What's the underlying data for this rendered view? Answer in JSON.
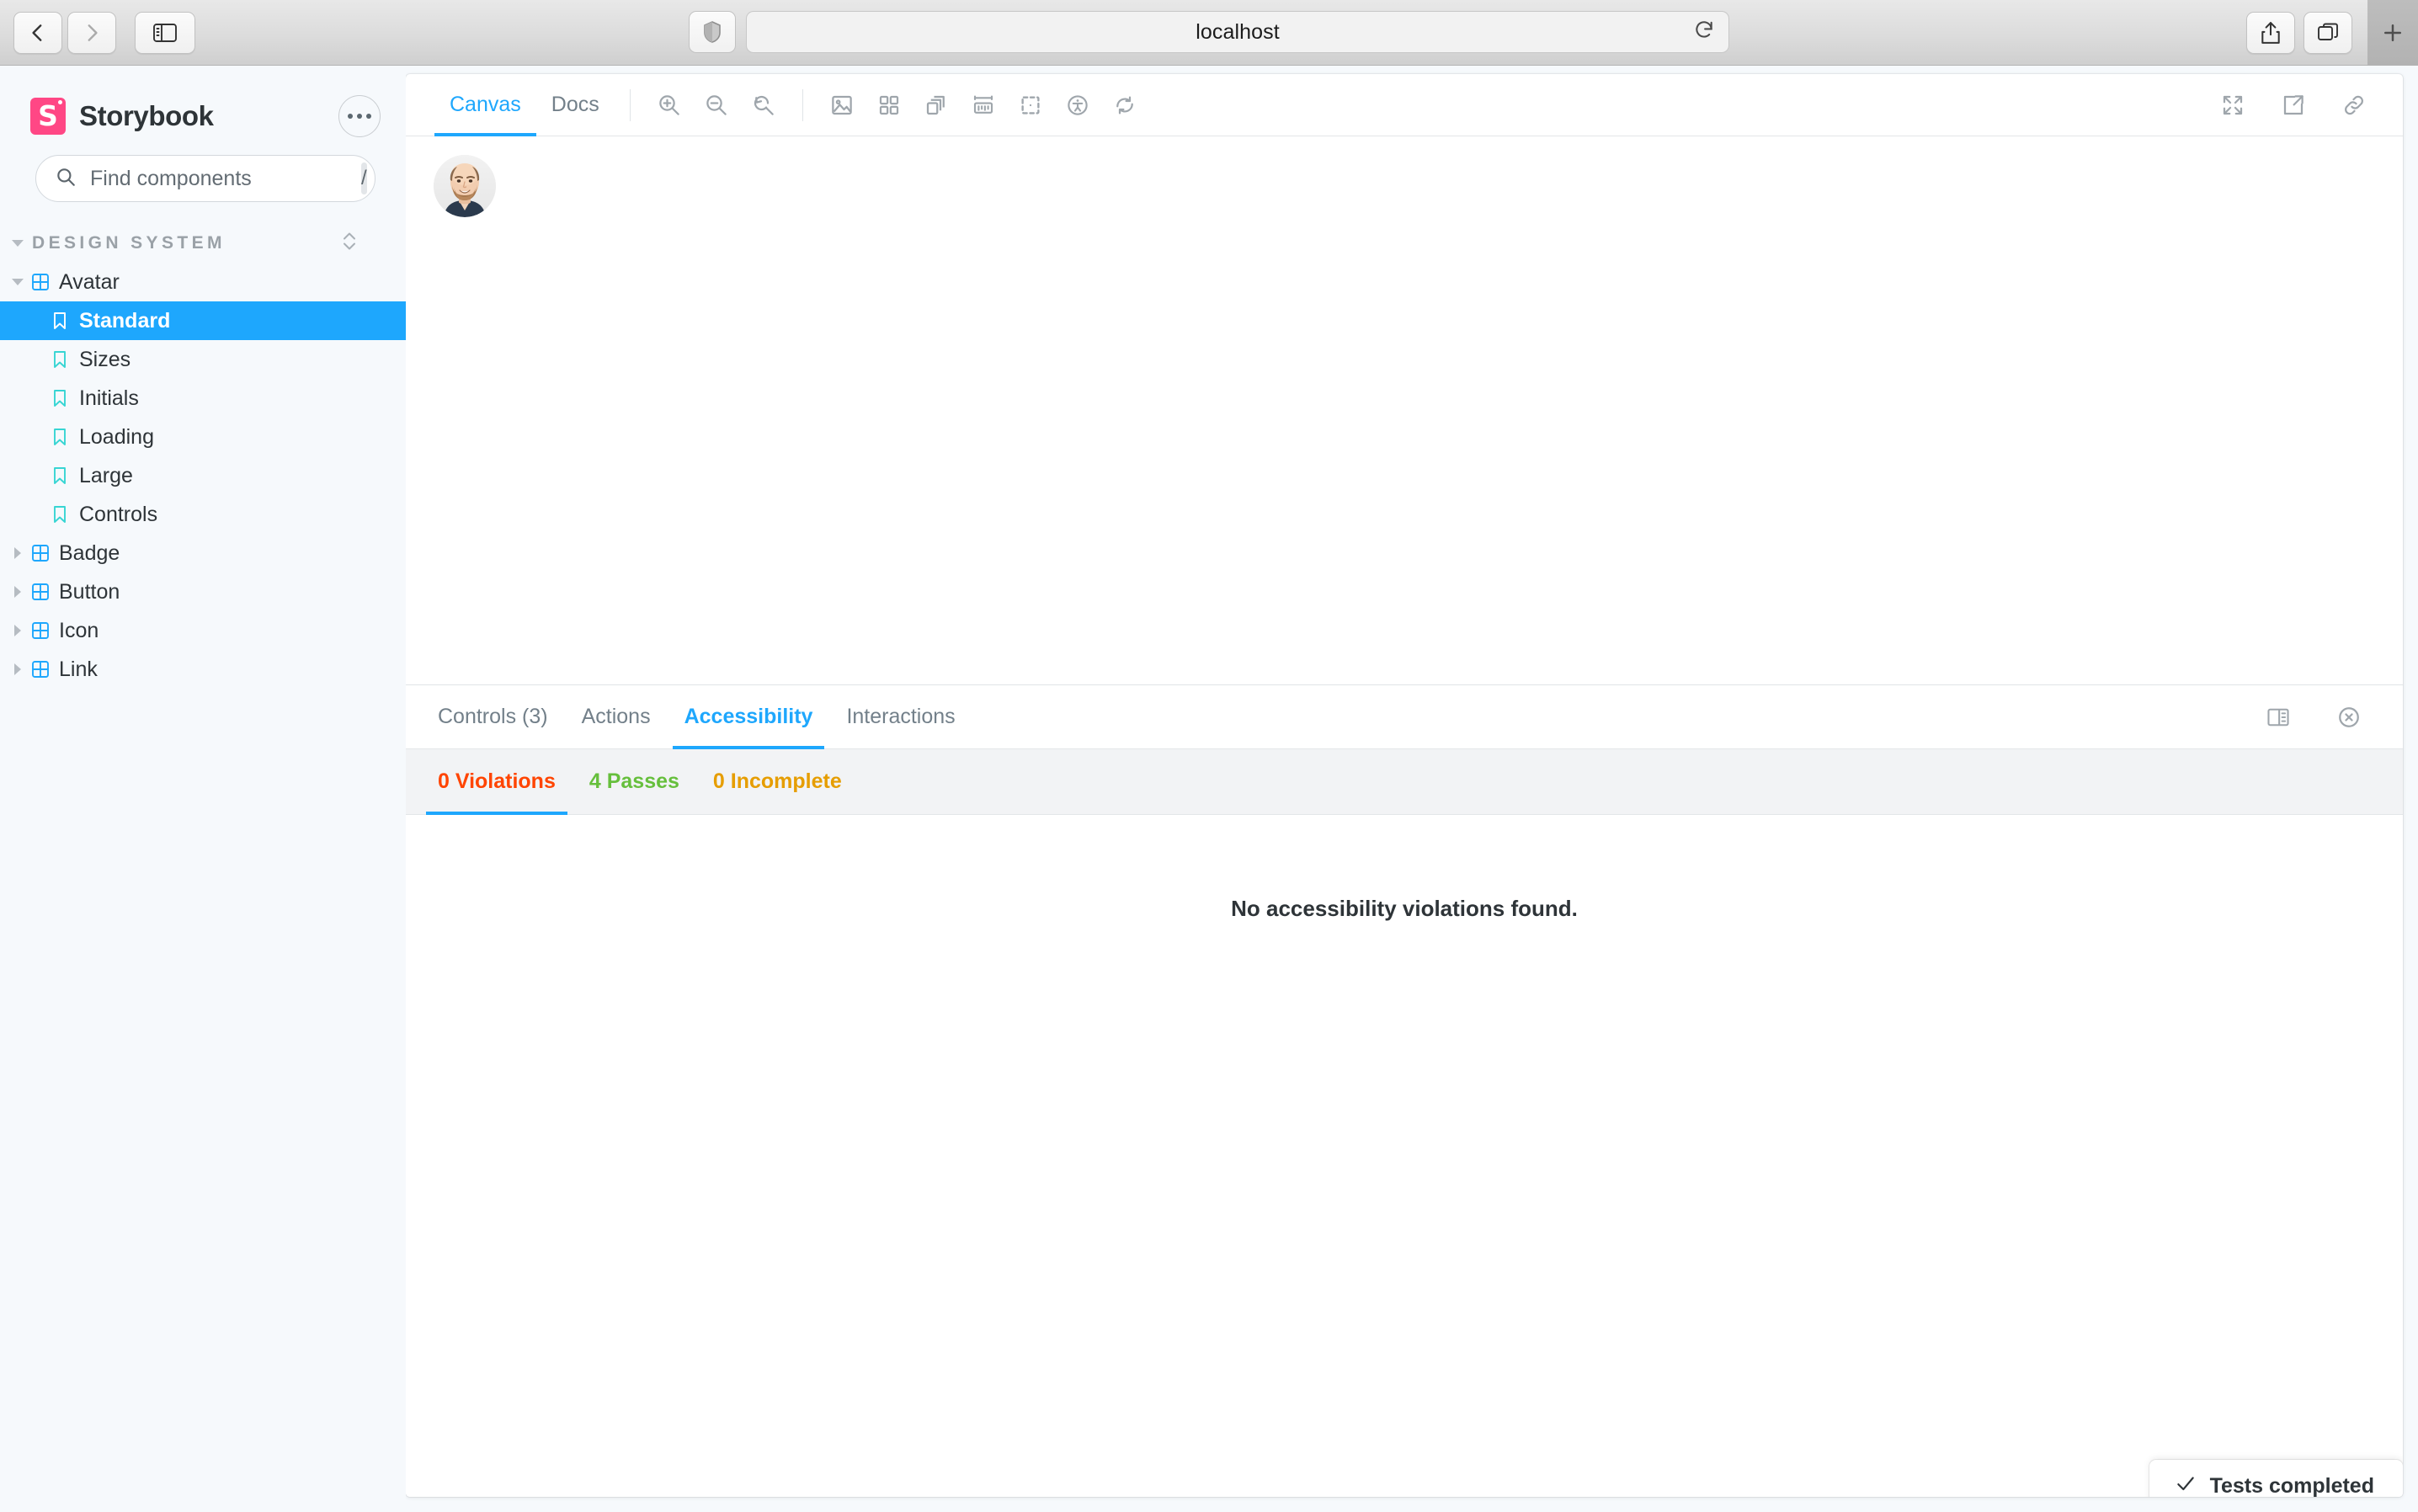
{
  "browser": {
    "url": "localhost",
    "back_label": "Back",
    "forward_label": "Forward",
    "sidebar_toggle_label": "Show sidebar",
    "shield_label": "Privacy report",
    "reload_label": "Reload",
    "share_label": "Share",
    "tabs_label": "Tab overview",
    "newtab_label": "New tab"
  },
  "sidebar": {
    "brand_name": "Storybook",
    "menu_label": "More actions",
    "search": {
      "placeholder": "Find components",
      "value": "",
      "shortcut": "/"
    },
    "section": {
      "label": "DESIGN SYSTEM",
      "sort_label": "Sort stories"
    },
    "tree": [
      {
        "label": "Avatar",
        "type": "component",
        "expanded": true,
        "selected": false,
        "depth": 0
      },
      {
        "label": "Standard",
        "type": "story",
        "expanded": false,
        "selected": true,
        "depth": 1
      },
      {
        "label": "Sizes",
        "type": "story",
        "expanded": false,
        "selected": false,
        "depth": 1
      },
      {
        "label": "Initials",
        "type": "story",
        "expanded": false,
        "selected": false,
        "depth": 1
      },
      {
        "label": "Loading",
        "type": "story",
        "expanded": false,
        "selected": false,
        "depth": 1
      },
      {
        "label": "Large",
        "type": "story",
        "expanded": false,
        "selected": false,
        "depth": 1
      },
      {
        "label": "Controls",
        "type": "story",
        "expanded": false,
        "selected": false,
        "depth": 1
      },
      {
        "label": "Badge",
        "type": "component",
        "expanded": false,
        "selected": false,
        "depth": 0
      },
      {
        "label": "Button",
        "type": "component",
        "expanded": false,
        "selected": false,
        "depth": 0
      },
      {
        "label": "Icon",
        "type": "component",
        "expanded": false,
        "selected": false,
        "depth": 0
      },
      {
        "label": "Link",
        "type": "component",
        "expanded": false,
        "selected": false,
        "depth": 0
      }
    ]
  },
  "toolbar": {
    "tabs": [
      {
        "label": "Canvas",
        "active": true
      },
      {
        "label": "Docs",
        "active": false
      }
    ],
    "tools": [
      {
        "name": "zoom-in-icon",
        "title": "Zoom in"
      },
      {
        "name": "zoom-out-icon",
        "title": "Zoom out"
      },
      {
        "name": "zoom-reset-icon",
        "title": "Reset zoom"
      },
      {
        "name": "backgrounds-icon",
        "title": "Change the background of the preview"
      },
      {
        "name": "grid-icon",
        "title": "Apply a grid to the preview"
      },
      {
        "name": "viewport-icon",
        "title": "Change the size of the preview"
      },
      {
        "name": "measure-icon",
        "title": "Enable measure"
      },
      {
        "name": "outline-icon",
        "title": "Apply outlines to the preview"
      },
      {
        "name": "accessibility-icon",
        "title": "Accessibility"
      },
      {
        "name": "refresh-icon",
        "title": "Remount component"
      }
    ],
    "right_tools": [
      {
        "name": "fullscreen-icon",
        "title": "Go full screen"
      },
      {
        "name": "open-new-tab-icon",
        "title": "Open canvas in new tab"
      },
      {
        "name": "copy-link-icon",
        "title": "Copy canvas link"
      }
    ]
  },
  "canvas": {
    "story_name": "Standard",
    "preview_item": "avatar-image"
  },
  "addon_panel": {
    "tabs": [
      {
        "label": "Controls (3)",
        "active": false
      },
      {
        "label": "Actions",
        "active": false
      },
      {
        "label": "Accessibility",
        "active": true
      },
      {
        "label": "Interactions",
        "active": false
      }
    ],
    "right_tools": [
      {
        "name": "panel-position-icon",
        "title": "Change addon orientation"
      },
      {
        "name": "close-panel-icon",
        "title": "Hide addons"
      }
    ],
    "a11y": {
      "subtabs": [
        {
          "label": "0 Violations",
          "color": "#ff4400",
          "active": true
        },
        {
          "label": "4 Passes",
          "color": "#66bf3c",
          "active": false
        },
        {
          "label": "0 Incomplete",
          "color": "#e69d00",
          "active": false
        }
      ],
      "empty_message": "No accessibility violations found."
    }
  },
  "toast": {
    "label": "Tests completed",
    "icon": "check-icon"
  },
  "colors": {
    "accent": "#1ea7fd",
    "brand": "#ff4785",
    "sidebar_bg": "#f6f9fc",
    "violation": "#ff4400",
    "pass": "#66bf3c",
    "incomplete": "#e69d00"
  }
}
